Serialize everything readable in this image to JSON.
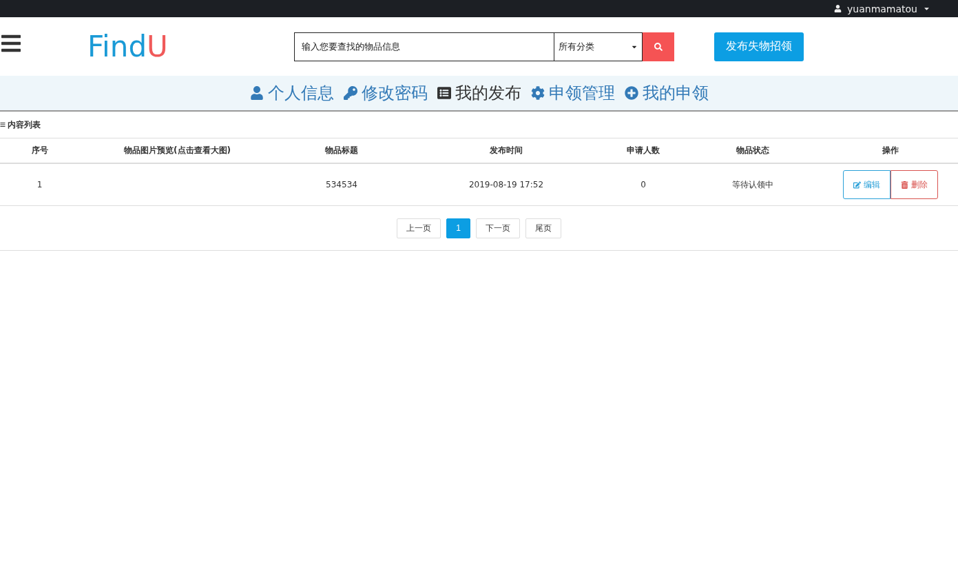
{
  "top_bar": {
    "username": "yuanmamatou"
  },
  "header": {
    "logo": {
      "first": "Find",
      "second": "U"
    },
    "search": {
      "placeholder": "输入您要查找的物品信息",
      "category": "所有分类"
    },
    "publish_button": "发布失物招领"
  },
  "nav": [
    {
      "label": "个人信息",
      "selected": false
    },
    {
      "label": "修改密码",
      "selected": false
    },
    {
      "label": "我的发布",
      "selected": true
    },
    {
      "label": "申领管理",
      "selected": false
    },
    {
      "label": "我的申领",
      "selected": false
    }
  ],
  "panel": {
    "title": "内容列表"
  },
  "table": {
    "columns": [
      "序号",
      "物品图片预览(点击查看大图)",
      "物品标题",
      "发布时间",
      "申请人数",
      "物品状态",
      "操作"
    ],
    "rows": [
      {
        "index": "1",
        "title": "534534",
        "time": "2019-08-19 17:52",
        "applicants": "0",
        "status": "等待认领中",
        "actions": [
          {
            "kind": "edit",
            "label": "编辑"
          },
          {
            "kind": "delete",
            "label": "删除"
          }
        ]
      }
    ]
  },
  "pagination": [
    {
      "label": "上一页",
      "selected": false
    },
    {
      "label": "1",
      "selected": true
    },
    {
      "label": "下一页",
      "selected": false
    },
    {
      "label": "尾页",
      "selected": false
    }
  ]
}
